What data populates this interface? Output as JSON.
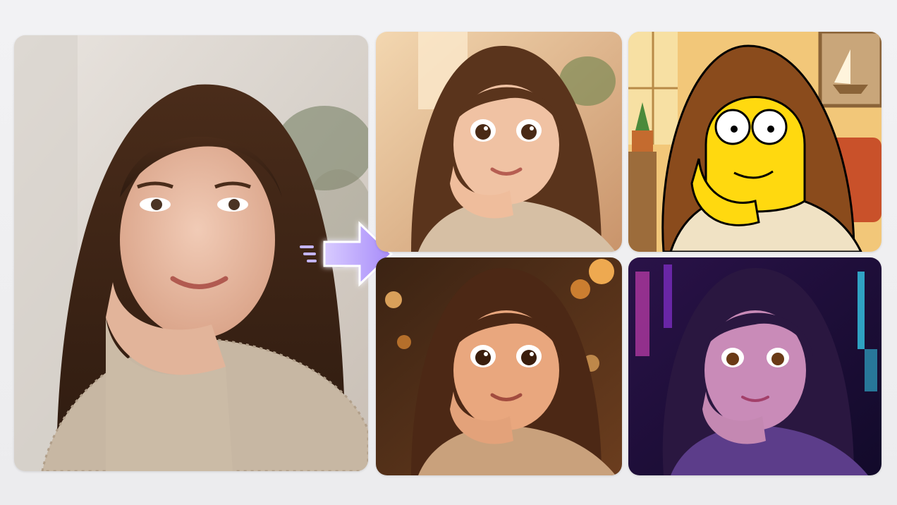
{
  "images": {
    "original": {
      "icon": "woman-portrait-photo"
    },
    "styles": [
      {
        "icon": "pixar-style-portrait"
      },
      {
        "icon": "simpsons-style-portrait"
      },
      {
        "icon": "pixar-night-style-portrait"
      },
      {
        "icon": "anime-neon-style-portrait"
      }
    ]
  },
  "colors": {
    "background": "#efeff1",
    "arrow_fill": "#a78bfa",
    "arrow_glow": "#c4b5fd",
    "hair_brown": "#5a341c",
    "simpsons_yellow": "#ffd90f",
    "neon_purple": "#7b2cbf"
  }
}
